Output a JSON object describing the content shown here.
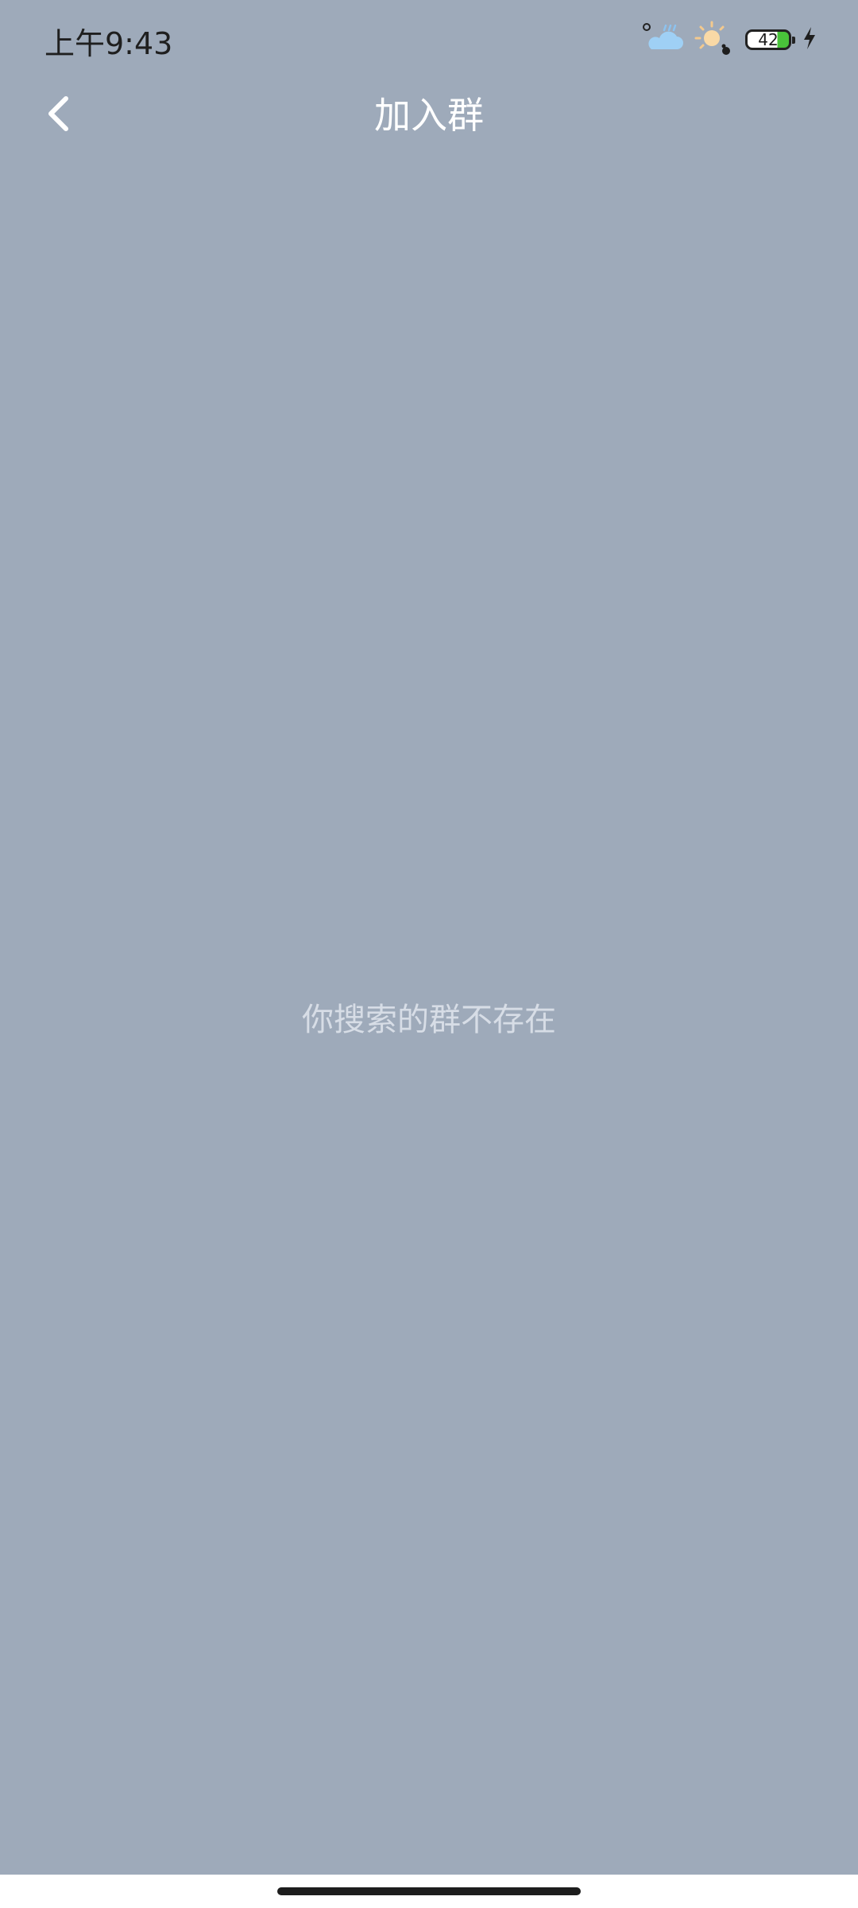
{
  "status_bar": {
    "time": "上午9:43",
    "battery_level": "42",
    "icons": [
      "weather-cloud-icon",
      "weather-sun-icon",
      "battery-icon",
      "charging-bolt-icon"
    ]
  },
  "nav": {
    "title": "加入群",
    "back_icon": "chevron-left-icon"
  },
  "main": {
    "empty_message": "你搜索的群不存在"
  },
  "colors": {
    "background": "#9eaaba",
    "title_text": "#ffffff",
    "message_text": "#d7dde6",
    "battery_fill": "#49c33a"
  }
}
